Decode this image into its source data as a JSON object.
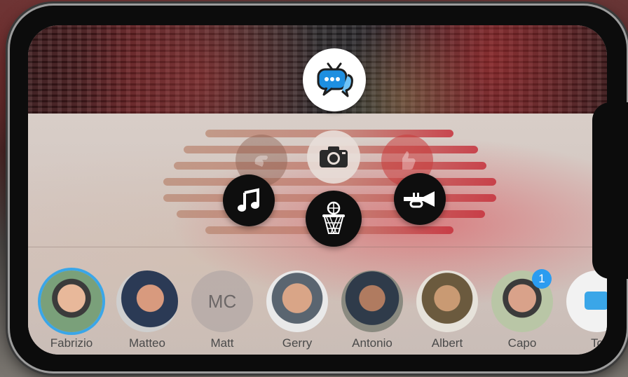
{
  "app": {
    "logo_icon": "chat-tv-icon"
  },
  "actions": [
    {
      "name": "music",
      "icon": "music-note-icon"
    },
    {
      "name": "camera",
      "icon": "camera-icon"
    },
    {
      "name": "basketball",
      "icon": "basketball-hoop-icon"
    },
    {
      "name": "trumpet",
      "icon": "trumpet-icon"
    }
  ],
  "contacts": [
    {
      "name": "Fabrizio",
      "selected": true
    },
    {
      "name": "Matteo"
    },
    {
      "name": "Matt",
      "initials": "MC"
    },
    {
      "name": "Gerry"
    },
    {
      "name": "Antonio"
    },
    {
      "name": "Albert"
    },
    {
      "name": "Capo",
      "badge": "1"
    },
    {
      "name": "To"
    }
  ],
  "colors": {
    "accent": "#3aa6e8",
    "badge": "#2b9cf0"
  }
}
